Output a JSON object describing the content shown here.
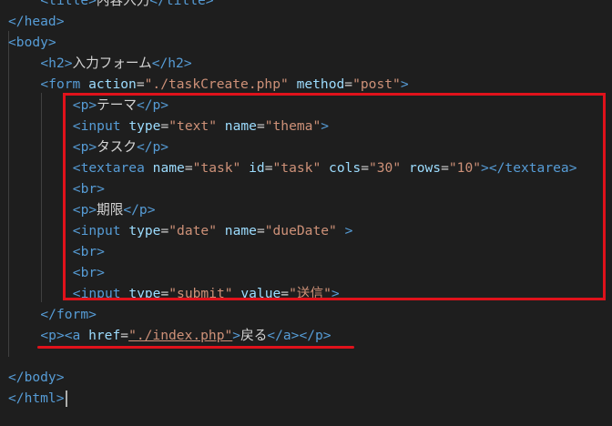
{
  "editor": {
    "lines": [
      {
        "indent": 4,
        "tokens": [
          [
            "tag",
            "<title>"
          ],
          [
            "txt",
            "内容入力"
          ],
          [
            "tag",
            "</title>"
          ]
        ]
      },
      {
        "indent": 0,
        "tokens": [
          [
            "tag",
            "</head>"
          ]
        ]
      },
      {
        "indent": 0,
        "tokens": [
          [
            "tag",
            "<body>"
          ]
        ]
      },
      {
        "indent": 4,
        "tokens": [
          [
            "tag",
            "<h2>"
          ],
          [
            "txt",
            "入力フォーム"
          ],
          [
            "tag",
            "</h2>"
          ]
        ]
      },
      {
        "indent": 4,
        "tokens": [
          [
            "tag",
            "<form "
          ],
          [
            "attr",
            "action"
          ],
          [
            "txt",
            "="
          ],
          [
            "str",
            "\"./taskCreate.php\""
          ],
          [
            "txt",
            " "
          ],
          [
            "attr",
            "method"
          ],
          [
            "txt",
            "="
          ],
          [
            "str",
            "\"post\""
          ],
          [
            "tag",
            ">"
          ]
        ]
      },
      {
        "indent": 8,
        "tokens": [
          [
            "tag",
            "<p>"
          ],
          [
            "txt",
            "テーマ"
          ],
          [
            "tag",
            "</p>"
          ]
        ]
      },
      {
        "indent": 8,
        "tokens": [
          [
            "tag",
            "<input "
          ],
          [
            "attr",
            "type"
          ],
          [
            "txt",
            "="
          ],
          [
            "str",
            "\"text\""
          ],
          [
            "txt",
            " "
          ],
          [
            "attr",
            "name"
          ],
          [
            "txt",
            "="
          ],
          [
            "str",
            "\"thema\""
          ],
          [
            "tag",
            ">"
          ]
        ]
      },
      {
        "indent": 8,
        "tokens": [
          [
            "tag",
            "<p>"
          ],
          [
            "txt",
            "タスク"
          ],
          [
            "tag",
            "</p>"
          ]
        ]
      },
      {
        "indent": 8,
        "tokens": [
          [
            "tag",
            "<textarea "
          ],
          [
            "attr",
            "name"
          ],
          [
            "txt",
            "="
          ],
          [
            "str",
            "\"task\""
          ],
          [
            "txt",
            " "
          ],
          [
            "attr",
            "id"
          ],
          [
            "txt",
            "="
          ],
          [
            "str",
            "\"task\""
          ],
          [
            "txt",
            " "
          ],
          [
            "attr",
            "cols"
          ],
          [
            "txt",
            "="
          ],
          [
            "str",
            "\"30\""
          ],
          [
            "txt",
            " "
          ],
          [
            "attr",
            "rows"
          ],
          [
            "txt",
            "="
          ],
          [
            "str",
            "\"10\""
          ],
          [
            "tag",
            "></textarea>"
          ]
        ]
      },
      {
        "indent": 8,
        "tokens": [
          [
            "tag",
            "<br>"
          ]
        ]
      },
      {
        "indent": 8,
        "tokens": [
          [
            "tag",
            "<p>"
          ],
          [
            "txt",
            "期限"
          ],
          [
            "tag",
            "</p>"
          ]
        ]
      },
      {
        "indent": 8,
        "tokens": [
          [
            "tag",
            "<input "
          ],
          [
            "attr",
            "type"
          ],
          [
            "txt",
            "="
          ],
          [
            "str",
            "\"date\""
          ],
          [
            "txt",
            " "
          ],
          [
            "attr",
            "name"
          ],
          [
            "txt",
            "="
          ],
          [
            "str",
            "\"dueDate\""
          ],
          [
            "txt",
            " "
          ],
          [
            "tag",
            ">"
          ]
        ]
      },
      {
        "indent": 8,
        "tokens": [
          [
            "tag",
            "<br>"
          ]
        ]
      },
      {
        "indent": 8,
        "tokens": [
          [
            "tag",
            "<br>"
          ]
        ]
      },
      {
        "indent": 8,
        "tokens": [
          [
            "tag",
            "<input "
          ],
          [
            "attr",
            "type"
          ],
          [
            "txt",
            "="
          ],
          [
            "str",
            "\"submit\""
          ],
          [
            "txt",
            " "
          ],
          [
            "attr",
            "value"
          ],
          [
            "txt",
            "="
          ],
          [
            "str",
            "\"送信\""
          ],
          [
            "tag",
            ">"
          ]
        ]
      },
      {
        "indent": 4,
        "tokens": [
          [
            "tag",
            "</form>"
          ]
        ]
      },
      {
        "indent": 4,
        "tokens": [
          [
            "tag",
            "<p><a "
          ],
          [
            "attr",
            "href"
          ],
          [
            "txt",
            "="
          ],
          [
            "link",
            "\"./index.php\""
          ],
          [
            "tag",
            ">"
          ],
          [
            "txt",
            "戻る"
          ],
          [
            "tag",
            "</a></p>"
          ]
        ]
      },
      {
        "indent": 0,
        "tokens": []
      },
      {
        "indent": 0,
        "tokens": [
          [
            "tag",
            "</body>"
          ]
        ]
      },
      {
        "indent": 0,
        "tokens": [
          [
            "tag",
            "</html>"
          ]
        ],
        "cursor": true
      }
    ]
  },
  "colors": {
    "background": "#1e1e1e",
    "tag": "#569cd6",
    "attribute": "#9cdcfe",
    "string": "#ce9178",
    "text": "#d4d4d4",
    "highlight": "#e0121b"
  }
}
